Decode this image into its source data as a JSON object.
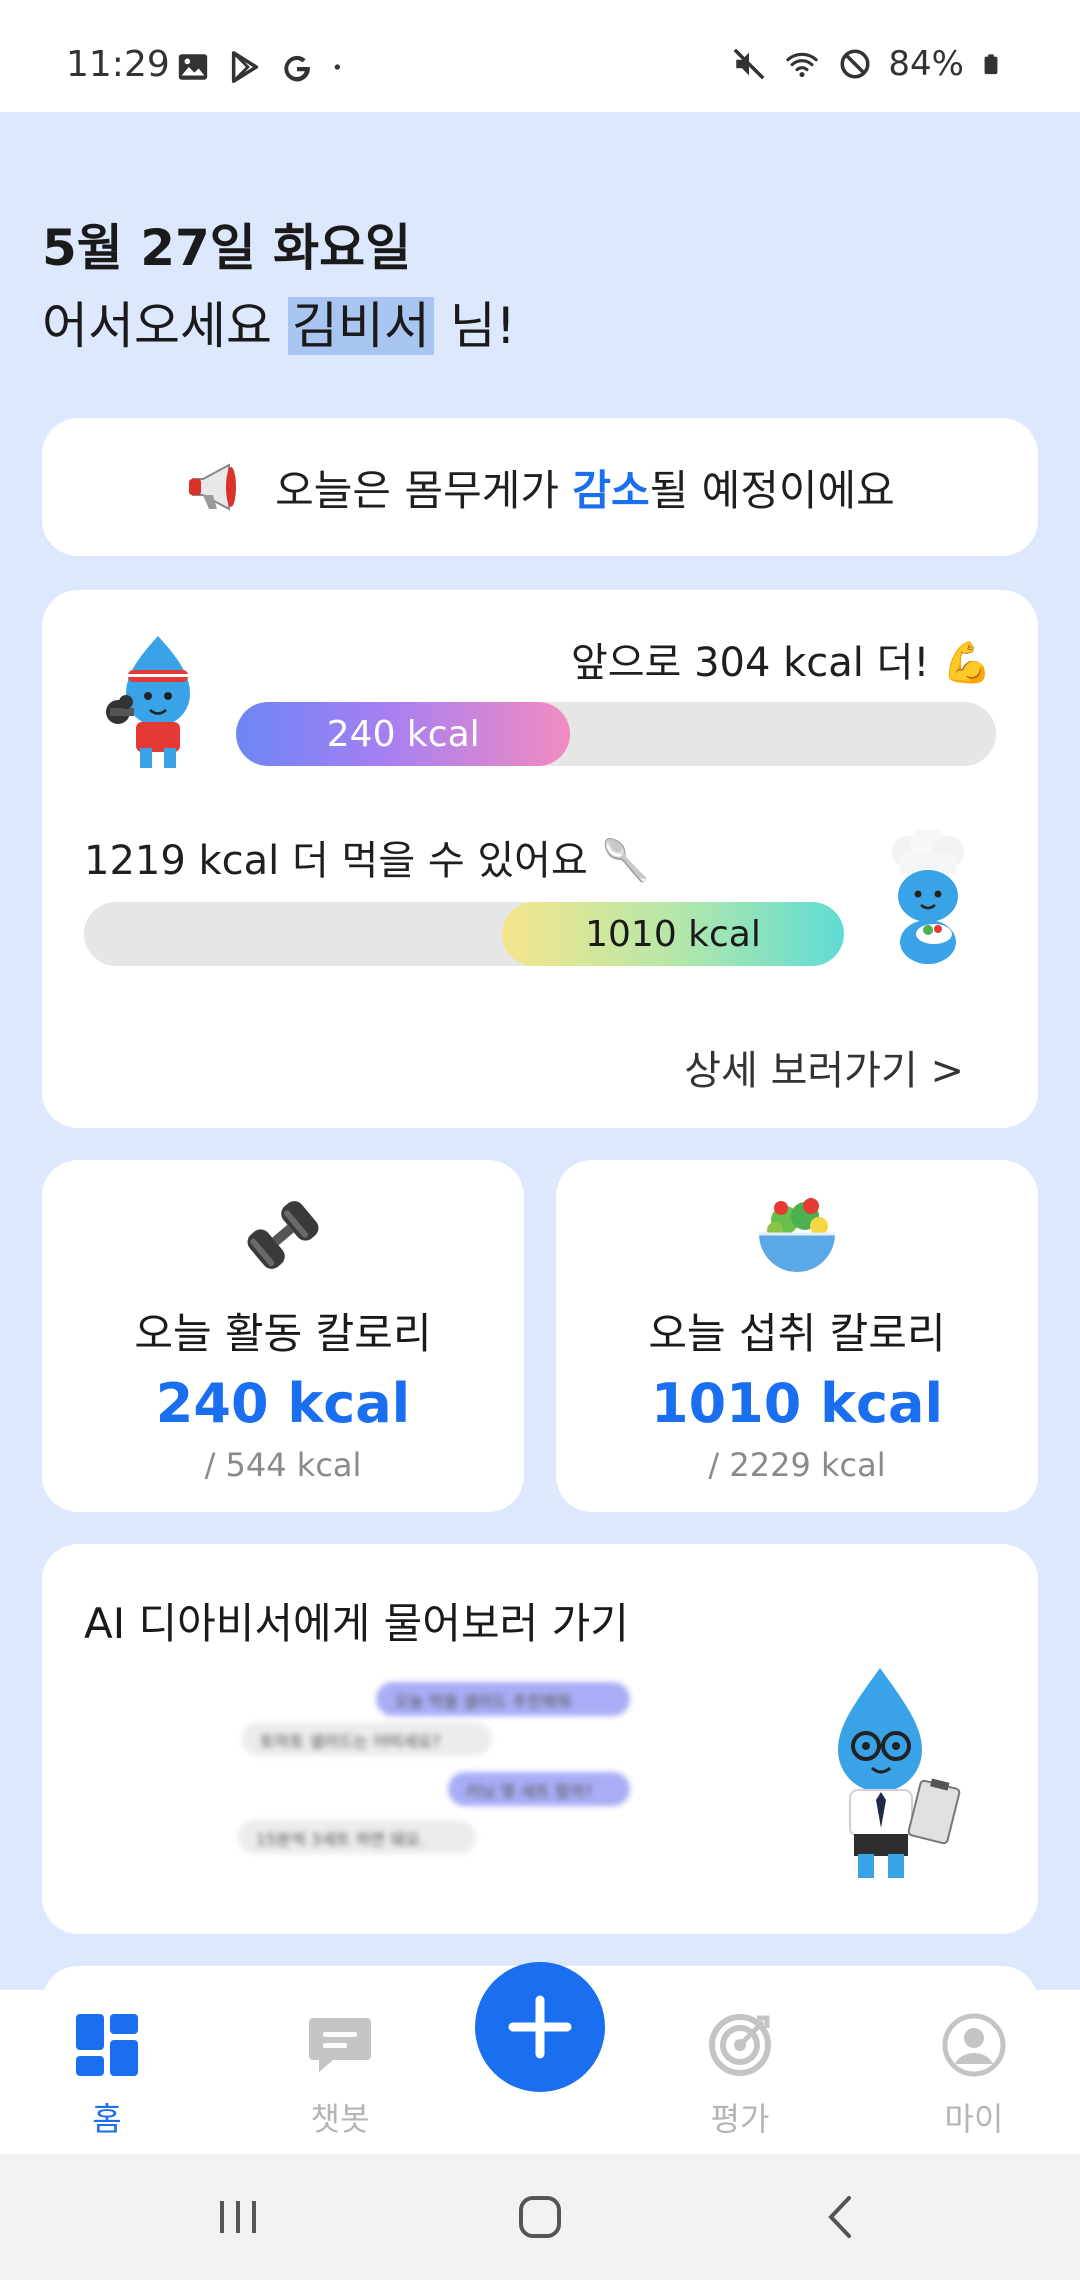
{
  "status_bar": {
    "time": "11:29",
    "battery": "84%",
    "left_icons": [
      "gallery-icon",
      "play-store-icon",
      "google-icon",
      "dot-icon"
    ],
    "right_icons": [
      "mute-icon",
      "wifi-icon",
      "block-icon",
      "battery-icon"
    ]
  },
  "greeting": {
    "date": "5월 27일 화요일",
    "prefix": "어서오세요 ",
    "name": "김비서",
    "suffix": " 님!"
  },
  "notice": {
    "icon": "megaphone-icon",
    "before": "오늘은 몸무게가 ",
    "highlight": "감소",
    "after": "될 예정이에요"
  },
  "progress": {
    "burn_label": "앞으로 304  kcal 더!",
    "burn_emoji": "💪",
    "burn_value_label": "240 kcal",
    "burn_fraction": 0.44,
    "eat_label": "1219 kcal 더 먹을 수 있어요",
    "eat_emoji": "🥄",
    "eat_value_label": "1010 kcal",
    "eat_fraction": 0.45,
    "detail_link": "상세 보러가기 >"
  },
  "stats": {
    "activity": {
      "icon": "dumbbell-icon",
      "title": "오늘 활동 칼로리",
      "value": "240 kcal",
      "goal": "/ 544 kcal"
    },
    "intake": {
      "icon": "salad-icon",
      "title": "오늘 섭취 칼로리",
      "value": "1010 kcal",
      "goal": "/ 2229 kcal"
    }
  },
  "ai_card": {
    "title": "AI 디아비서에게 물어보러 가기",
    "bubbles": [
      {
        "from": "me",
        "text": "오늘 먹을 샐러드 추천해줘"
      },
      {
        "from": "bot",
        "text": "토마토 샐러드는 어떠세요?"
      },
      {
        "from": "me",
        "text": "러닝 몇 세트 할까?"
      },
      {
        "from": "bot",
        "text": "15분씩 3세트 하면 돼요."
      }
    ]
  },
  "bottom_nav": {
    "items": [
      {
        "label": "홈",
        "icon": "home-grid-icon",
        "active": true
      },
      {
        "label": "챗봇",
        "icon": "chat-icon",
        "active": false
      },
      {
        "label": "평가",
        "icon": "target-icon",
        "active": false
      },
      {
        "label": "마이",
        "icon": "profile-icon",
        "active": false
      }
    ],
    "fab_icon": "plus-icon"
  },
  "colors": {
    "accent": "#1a6ff0",
    "background": "#dde7fd",
    "card": "#ffffff",
    "muted": "#8a8a8a"
  }
}
